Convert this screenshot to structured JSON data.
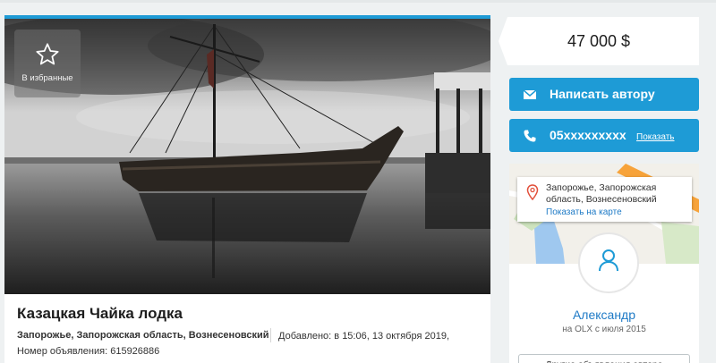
{
  "favorite": {
    "label": "В избранные"
  },
  "ad": {
    "title": "Казацкая Чайка лодка",
    "location": "Запорожье, Запорожская область, Вознесеновский",
    "added": "Добавлено: в 15:06, 13 октября 2019,",
    "number": "Номер объявления: 615926886"
  },
  "sidebar": {
    "price": "47 000 $",
    "message_button": "Написать автору",
    "phone": "05xxxxxxxxx",
    "phone_show": "Показать",
    "map_address": "Запорожье, Запорожская область, Вознесеновский",
    "map_link": "Показать на карте",
    "seller_name": "Александр",
    "seller_since": "на OLX с июля 2015",
    "other_ads": "Другие объявления автора"
  },
  "colors": {
    "accent": "#1e9bd6",
    "link": "#1e7ac6"
  },
  "icons": {
    "favorite": "star-icon",
    "message": "envelope-icon",
    "phone": "phone-icon",
    "map_pin": "map-pin-icon",
    "avatar": "user-icon"
  }
}
